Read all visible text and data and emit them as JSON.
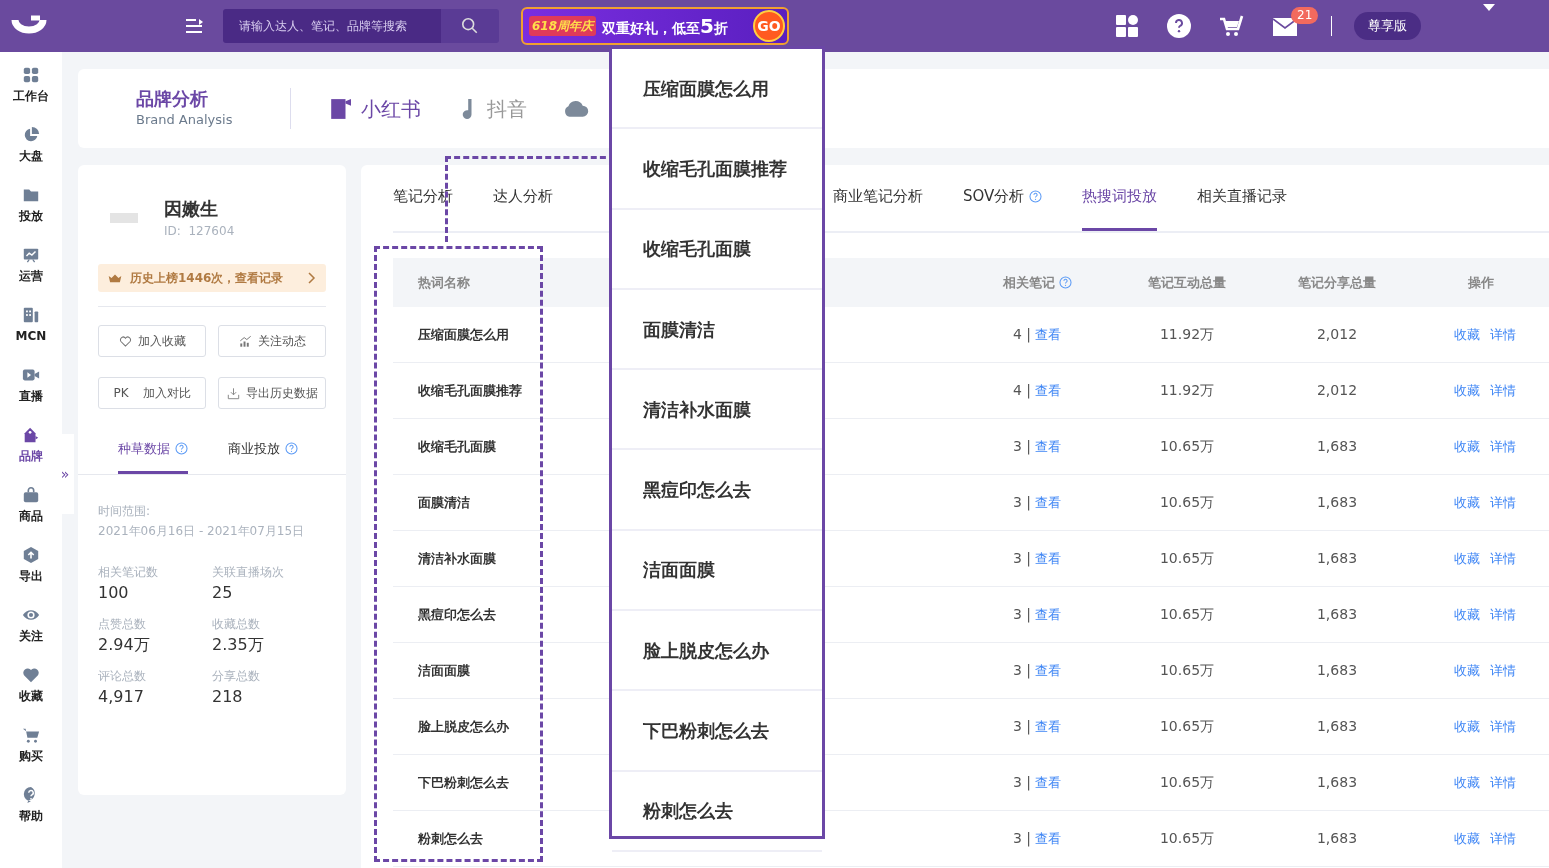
{
  "topbar": {
    "search": {
      "placeholder": "请输入达人、笔记、品牌等搜索"
    },
    "promo": {
      "tag": "618周年庆",
      "text": "双重好礼，低至",
      "highlight": "5",
      "suffix": "折",
      "button": "GO"
    },
    "mail_badge": "21",
    "plan": "尊享版"
  },
  "sidebar": {
    "items": [
      {
        "label": "工作台",
        "selected": false
      },
      {
        "label": "大盘",
        "selected": false
      },
      {
        "label": "投放",
        "selected": false
      },
      {
        "label": "运营",
        "selected": false
      },
      {
        "label": "MCN",
        "selected": false
      },
      {
        "label": "直播",
        "selected": false
      },
      {
        "label": "品牌",
        "selected": true
      },
      {
        "label": "商品",
        "selected": false
      },
      {
        "label": "导出",
        "selected": false
      },
      {
        "label": "关注",
        "selected": false
      },
      {
        "label": "收藏",
        "selected": false
      },
      {
        "label": "购买",
        "selected": false
      },
      {
        "label": "帮助",
        "selected": false
      }
    ],
    "toggle": "»"
  },
  "header": {
    "title": "品牌分析",
    "subtitle": "Brand Analysis",
    "platforms": [
      {
        "label": "小红书",
        "selected": true
      },
      {
        "label": "抖音",
        "selected": false
      },
      {
        "selected": false
      }
    ]
  },
  "brand": {
    "name": "因嫩生",
    "id": "ID:  127604",
    "ranking": "历史上榜1446次，查看记录",
    "actions": [
      {
        "kind": "heart",
        "label": "加入收藏"
      },
      {
        "kind": "chart",
        "label": "关注动态"
      },
      {
        "kind": "prefix",
        "prefix": "PK",
        "label": "加入对比"
      },
      {
        "kind": "download",
        "label": "导出历史数据"
      }
    ],
    "tabs": [
      {
        "label": "种草数据",
        "selected": true
      },
      {
        "label": "商业投放",
        "selected": false
      }
    ],
    "range_label": "时间范围:",
    "range": "2021年06月16日 - 2021年07月15日",
    "stats": [
      {
        "label": "相关笔记数",
        "value": "100"
      },
      {
        "label": "关联直播场次",
        "value": "25"
      },
      {
        "label": "点赞总数",
        "value": "2.94万"
      },
      {
        "label": "收藏总数",
        "value": "2.35万"
      },
      {
        "label": "评论总数",
        "value": "4,917"
      },
      {
        "label": "分享总数",
        "value": "218"
      }
    ]
  },
  "tabs_left": [
    {
      "label": "笔记分析",
      "selected": false,
      "help": false
    },
    {
      "label": "达人分析",
      "selected": false,
      "help": false
    }
  ],
  "tabs_right": [
    {
      "label": "商业笔记分析",
      "selected": false,
      "help": false
    },
    {
      "label": "SOV分析",
      "selected": false,
      "help": true
    },
    {
      "label": "热搜词投放",
      "selected": true,
      "help": false
    },
    {
      "label": "相关直播记录",
      "selected": false,
      "help": false
    }
  ],
  "table": {
    "columns": [
      {
        "label": "热词名称",
        "help": false
      },
      {
        "label": "相关笔记",
        "help": true
      },
      {
        "label": "笔记互动总量",
        "help": false
      },
      {
        "label": "笔记分享总量",
        "help": false
      },
      {
        "label": "操作",
        "help": false
      }
    ],
    "rows": [
      {
        "name": "压缩面膜怎么用",
        "notes": "4 |",
        "view": "查看",
        "interactions": "11.92万",
        "shares": "2,012",
        "actions": [
          "收藏",
          "详情"
        ]
      },
      {
        "name": "收缩毛孔面膜推荐",
        "notes": "4 |",
        "view": "查看",
        "interactions": "11.92万",
        "shares": "2,012",
        "actions": [
          "收藏",
          "详情"
        ]
      },
      {
        "name": "收缩毛孔面膜",
        "notes": "3 |",
        "view": "查看",
        "interactions": "10.65万",
        "shares": "1,683",
        "actions": [
          "收藏",
          "详情"
        ]
      },
      {
        "name": "面膜清洁",
        "notes": "3 |",
        "view": "查看",
        "interactions": "10.65万",
        "shares": "1,683",
        "actions": [
          "收藏",
          "详情"
        ]
      },
      {
        "name": "清洁补水面膜",
        "notes": "3 |",
        "view": "查看",
        "interactions": "10.65万",
        "shares": "1,683",
        "actions": [
          "收藏",
          "详情"
        ]
      },
      {
        "name": "黑痘印怎么去",
        "notes": "3 |",
        "view": "查看",
        "interactions": "10.65万",
        "shares": "1,683",
        "actions": [
          "收藏",
          "详情"
        ]
      },
      {
        "name": "洁面面膜",
        "notes": "3 |",
        "view": "查看",
        "interactions": "10.65万",
        "shares": "1,683",
        "actions": [
          "收藏",
          "详情"
        ]
      },
      {
        "name": "脸上脱皮怎么办",
        "notes": "3 |",
        "view": "查看",
        "interactions": "10.65万",
        "shares": "1,683",
        "actions": [
          "收藏",
          "详情"
        ]
      },
      {
        "name": "下巴粉刺怎么去",
        "notes": "3 |",
        "view": "查看",
        "interactions": "10.65万",
        "shares": "1,683",
        "actions": [
          "收藏",
          "详情"
        ]
      },
      {
        "name": "粉刺怎么去",
        "notes": "3 |",
        "view": "查看",
        "interactions": "10.65万",
        "shares": "1,683",
        "actions": [
          "收藏",
          "详情"
        ]
      }
    ]
  },
  "popup": {
    "items": [
      "压缩面膜怎么用",
      "收缩毛孔面膜推荐",
      "收缩毛孔面膜",
      "面膜清洁",
      "清洁补水面膜",
      "黑痘印怎么去",
      "洁面面膜",
      "脸上脱皮怎么办",
      "下巴粉刺怎么去",
      "粉刺怎么去"
    ]
  }
}
